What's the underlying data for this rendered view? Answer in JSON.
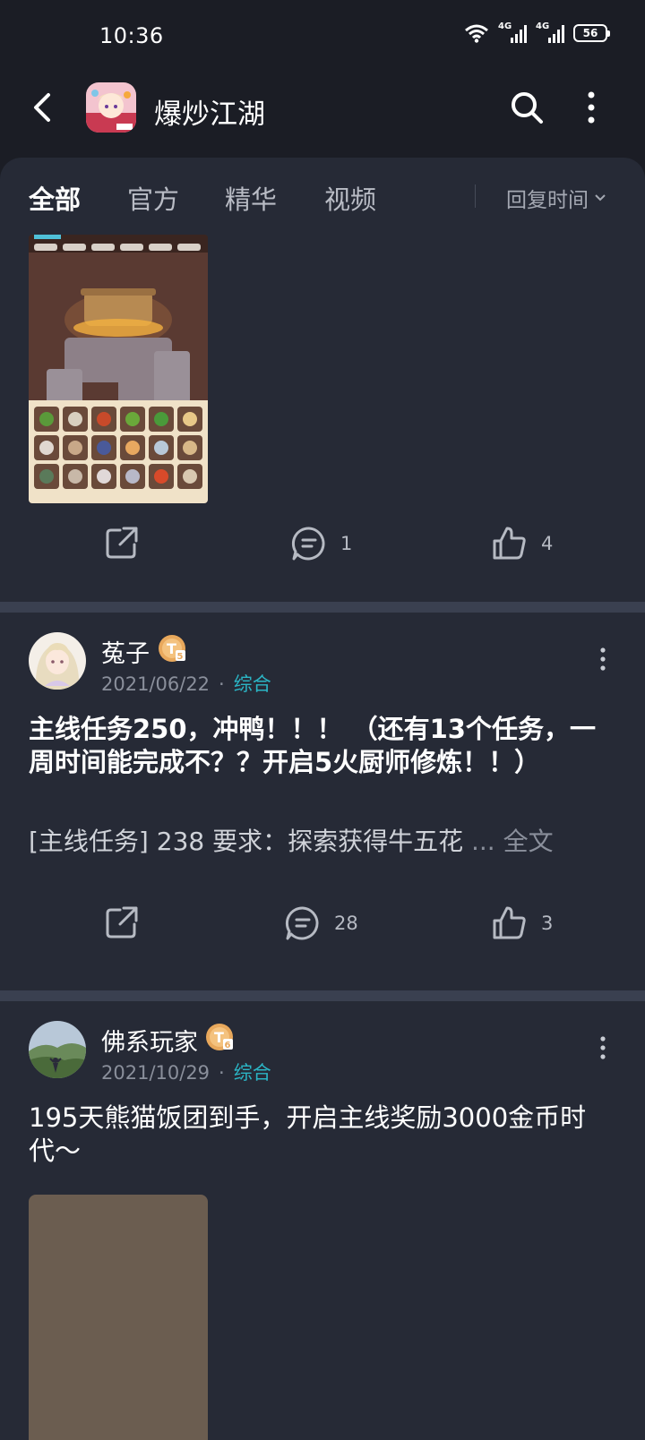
{
  "status_bar": {
    "time": "10:36",
    "signal1_label": "4G",
    "signal2_label": "4G",
    "battery": "56"
  },
  "header": {
    "title": "爆炒江湖",
    "back_icon": "back-arrow-icon",
    "search_icon": "search-icon",
    "more_icon": "more-vertical-icon"
  },
  "tabs": [
    {
      "label": "全部",
      "active": true
    },
    {
      "label": "官方",
      "active": false
    },
    {
      "label": "精华",
      "active": false
    },
    {
      "label": "视频",
      "active": false
    }
  ],
  "sort": {
    "label": "回复时间"
  },
  "posts": [
    {
      "has_image": true,
      "share_icon": "share-icon",
      "comments": "1",
      "likes": "4"
    },
    {
      "username": "菟子",
      "badge": "T5",
      "date": "2021/06/22",
      "dot": "·",
      "category": "综合",
      "title": "主线任务250，冲鸭！！！ （还有13个任务，一周时间能完成不？？开启5火厨师修炼！！）",
      "excerpt": "[主线任务] 238 要求：探索获得牛五花",
      "more_label": "... 全文",
      "comments": "28",
      "likes": "3"
    },
    {
      "username": "佛系玩家",
      "badge": "T6",
      "date": "2021/10/29",
      "dot": "·",
      "category": "综合",
      "title": "195天熊猫饭团到手，开启主线奖励3000金币时代～"
    }
  ],
  "colors": {
    "background": "#1b1d25",
    "panel": "#262a36",
    "accent_category": "#2bb5c5",
    "badge": "#e8a85c"
  }
}
